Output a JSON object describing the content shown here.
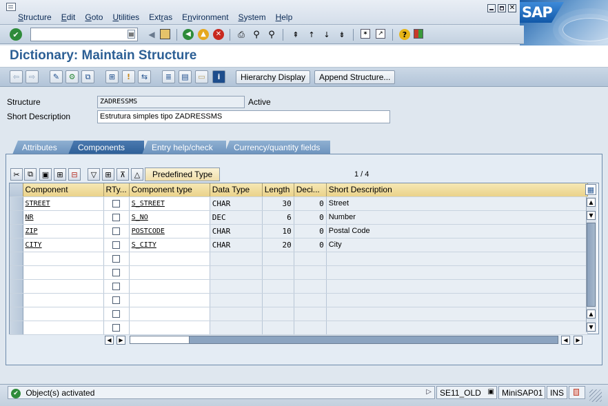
{
  "menubar": {
    "items": [
      "Structure",
      "Edit",
      "Goto",
      "Utilities",
      "Extras",
      "Environment",
      "System",
      "Help"
    ],
    "underline_index": [
      0,
      0,
      0,
      0,
      3,
      1,
      0,
      0
    ]
  },
  "toolbar": {
    "command_field_value": "",
    "icons": [
      "enter-icon",
      "command-field-dropdown-icon",
      "back-arrow-icon",
      "save-icon",
      "back-icon",
      "exit-icon",
      "cancel-icon",
      "print-icon",
      "find-icon",
      "find-next-icon",
      "first-page-icon",
      "previous-page-icon",
      "next-page-icon",
      "last-page-icon",
      "new-session-icon",
      "create-shortcut-icon",
      "help-icon",
      "customize-layout-icon"
    ]
  },
  "page": {
    "title": "Dictionary: Maintain Structure"
  },
  "app_toolbar": {
    "hierarchy_display": "Hierarchy Display",
    "append_structure": "Append Structure..."
  },
  "header": {
    "structure_label": "Structure",
    "structure_value": "ZADRESSMS",
    "status": "Active",
    "short_desc_label": "Short Description",
    "short_desc_value": "Estrutura simples tipo ZADRESSMS"
  },
  "tabs": [
    "Attributes",
    "Components",
    "Entry help/check",
    "Currency/quantity fields"
  ],
  "active_tab": "Components",
  "table_toolbar": {
    "predefined_type": "Predefined Type",
    "page_indicator": "1  /  4"
  },
  "grid": {
    "columns": [
      "Component",
      "RTy...",
      "Component type",
      "Data Type",
      "Length",
      "Deci...",
      "Short Description"
    ],
    "rows": [
      {
        "component": "STREET",
        "component_type": "S_STREET",
        "data_type": "CHAR",
        "length": "30",
        "decimals": "0",
        "description": "Street"
      },
      {
        "component": "NR",
        "component_type": "S_NO",
        "data_type": "DEC",
        "length": "6",
        "decimals": "0",
        "description": "Number"
      },
      {
        "component": "ZIP",
        "component_type": "POSTCODE",
        "data_type": "CHAR",
        "length": "10",
        "decimals": "0",
        "description": "Postal Code"
      },
      {
        "component": "CITY",
        "component_type": "S_CITY",
        "data_type": "CHAR",
        "length": "20",
        "decimals": "0",
        "description": "City"
      }
    ],
    "empty_rows": 6
  },
  "statusbar": {
    "message": "Object(s) activated",
    "transaction": "SE11_OLD",
    "system": "MiniSAP01",
    "mode": "INS"
  },
  "colors": {
    "title": "#2c5f95",
    "tab_active": "#2e5f97",
    "tab_inactive": "#6c93bd",
    "header_row": "#ead28a"
  }
}
